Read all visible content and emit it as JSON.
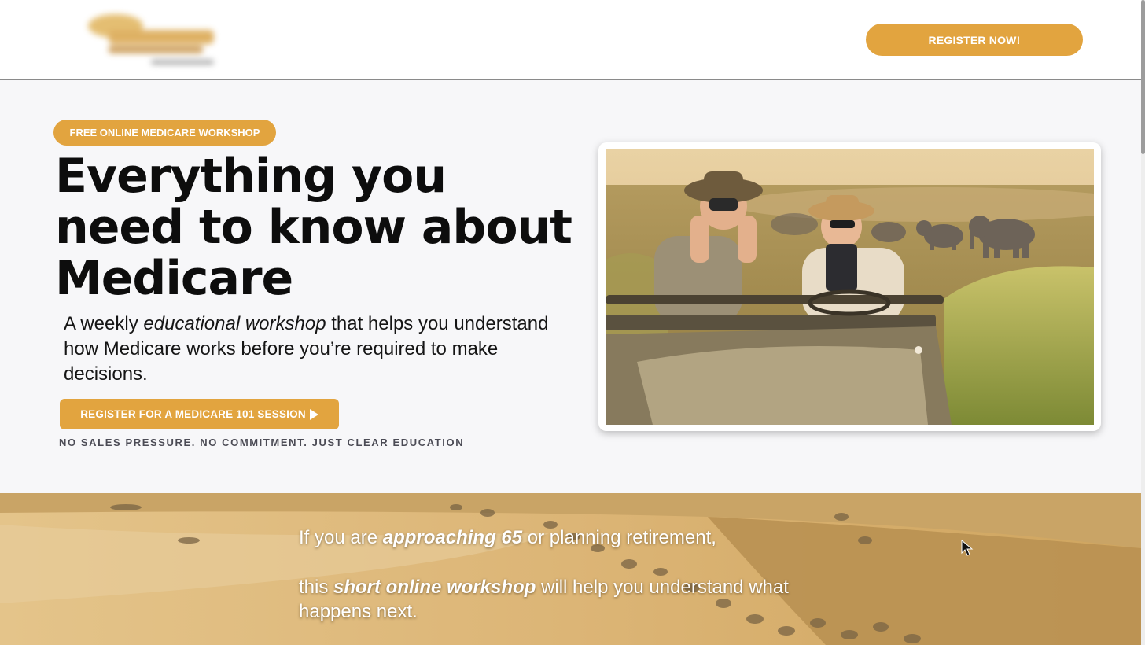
{
  "header": {
    "register_now_label": "REGISTER NOW!"
  },
  "hero": {
    "badge": "FREE ONLINE MEDICARE WORKSHOP",
    "headline_line1": "Everything you",
    "headline_line2": "need to know about",
    "headline_line3": "Medicare",
    "sub_part1": "A weekly ",
    "sub_em": "educational workshop",
    "sub_part2": " that helps you understand how Medicare works before you’re required to make decisions.",
    "cta_label": "REGISTER FOR A MEDICARE 101 SESSION",
    "note": "NO SALES PRESSURE. NO COMMITMENT. JUST CLEAR EDUCATION"
  },
  "banner": {
    "line1_a": "If you are ",
    "line1_em": "approaching 65",
    "line1_b": " or planning retirement,",
    "line2_a": "this ",
    "line2_em": "short online workshop",
    "line2_b": " will help you understand what happens next."
  },
  "colors": {
    "accent": "#e2a43f",
    "headline": "#0d0d0d",
    "background": "#f7f7f9"
  },
  "icons": {
    "play": "play-icon",
    "cursor": "mouse-pointer-icon"
  }
}
